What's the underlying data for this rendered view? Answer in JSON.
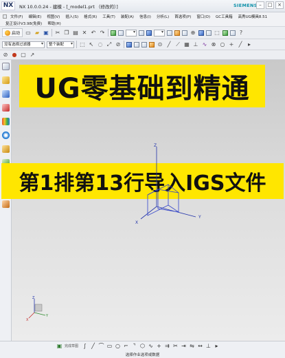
{
  "window": {
    "logo": "NX",
    "title": "NX 10.0.0.24 - 建模 - [_model1.prt （修改的）]",
    "brand": "SIEMENS"
  },
  "menu": {
    "row1": [
      "文件(F)",
      "编辑(E)",
      "视图(V)",
      "插入(S)",
      "格式(R)",
      "工具(T)",
      "装配(A)",
      "信息(I)",
      "分析(L)",
      "首选项(P)",
      "窗口(O)",
      "GC工具箱",
      "高秀UG模具8.51"
    ],
    "row2": [
      "复正设计V3.98(免费)",
      "帮助(H)"
    ]
  },
  "toolbar": {
    "start_label": "启动",
    "filter_value": "没有选择过滤器",
    "assembly_value": "整个装配"
  },
  "banners": {
    "top": "UG零基础到精通",
    "middle": "第1排第13行导入IGS文件"
  },
  "axes": {
    "x": "X",
    "y": "Y",
    "z": "Z"
  },
  "status": {
    "prompt": "选择作业选项或数据",
    "snap_label": "完成草图"
  },
  "colors": {
    "banner": "#ffe600",
    "axes": "#2233aa",
    "brand": "#0b8fa8"
  }
}
